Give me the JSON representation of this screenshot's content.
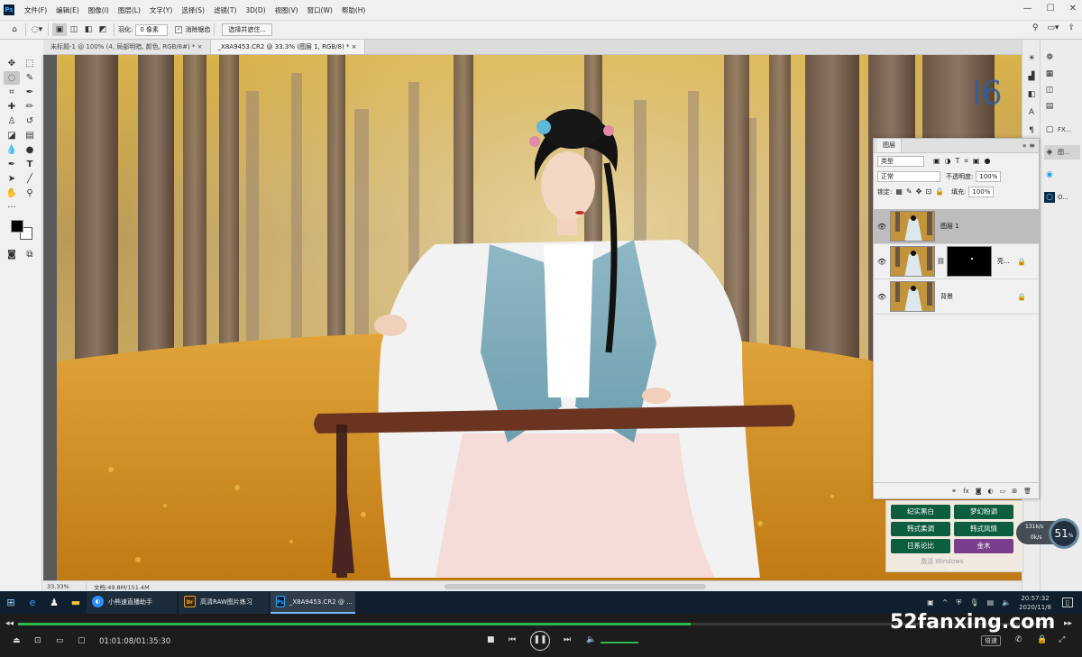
{
  "menubar": {
    "app_icon": "Ps",
    "items": [
      "文件(F)",
      "编辑(E)",
      "图像(I)",
      "图层(L)",
      "文字(Y)",
      "选择(S)",
      "滤镜(T)",
      "3D(D)",
      "视图(V)",
      "窗口(W)",
      "帮助(H)"
    ],
    "window_controls": [
      "—",
      "☐",
      "✕"
    ]
  },
  "options": {
    "feather_label": "羽化:",
    "feather_value": "0 像素",
    "antialias_label": "消除锯齿",
    "select_mask_button": "选择并遮住..."
  },
  "tabs": [
    {
      "label": "未标题-1 @ 100% (4, 局部明暗, 颜色, RGB/8#) *  ×"
    },
    {
      "label": "_X8A9453.CR2 @ 33.3% (图层 1, RGB/8) *  ×"
    }
  ],
  "status": {
    "zoom": "33.33%",
    "doc": "文档:49.8M/151.4M"
  },
  "layers_panel": {
    "tab": "图层",
    "kind_filter": "类型",
    "blend_mode": "正常",
    "opacity_label": "不透明度:",
    "opacity_value": "100%",
    "lock_label": "锁定:",
    "fill_label": "填充:",
    "fill_value": "100%",
    "layers": [
      {
        "name": "图层 1",
        "active": true
      },
      {
        "name": "亮..."
      },
      {
        "name": "背景"
      }
    ]
  },
  "plugin": {
    "buttons": [
      "纪实黑白",
      "梦幻粉调",
      "韩式柔调",
      "韩式风情",
      "日系论比",
      "金木"
    ],
    "activate": "激活 Windows"
  },
  "right_panel": {
    "items": [
      "FX...",
      "图...",
      "O..."
    ]
  },
  "taskbar": {
    "apps": [
      {
        "label": "小熊速直播助手",
        "badge": "◐"
      },
      {
        "label": "高清RAW图片练习",
        "badge": "Br"
      },
      {
        "label": "_X8A9453.CR2 @ ...",
        "badge": "Ps"
      }
    ],
    "clock_time": "20:57:32",
    "clock_date": "2020/11/8"
  },
  "player": {
    "time": "01:01:08/01:35:30",
    "progress": 0.65,
    "speed_label": "倍速"
  },
  "overlay": {
    "percent": "51",
    "unit": "%",
    "upload": "131k/s",
    "download": "0k/s"
  },
  "watermark": "52fanxing.com",
  "colors": {
    "accent": "#2db94f",
    "plugin_green": "#0c5e3e",
    "plugin_purple": "#7a3e8c"
  }
}
